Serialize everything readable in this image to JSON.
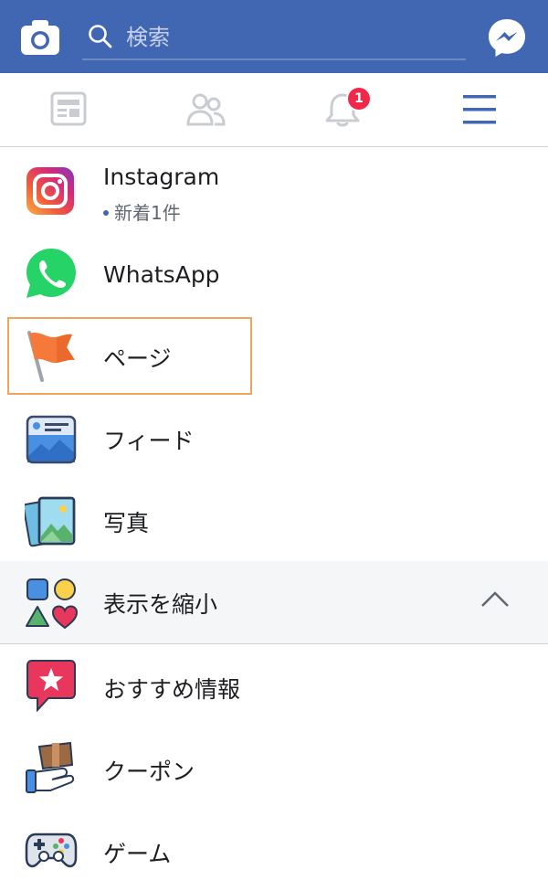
{
  "header": {
    "search_placeholder": "検索",
    "brand_color": "#4267b2"
  },
  "nav": {
    "tabs": [
      {
        "name": "news-feed-icon"
      },
      {
        "name": "friends-icon"
      },
      {
        "name": "notifications-icon",
        "badge": "1"
      },
      {
        "name": "menu-icon",
        "active": true
      }
    ],
    "notification_badge": "1"
  },
  "menu": {
    "items": [
      {
        "label": "Instagram",
        "sub": "新着1件",
        "icon": "instagram-icon"
      },
      {
        "label": "WhatsApp",
        "icon": "whatsapp-icon"
      },
      {
        "label": "ページ",
        "icon": "flag-icon"
      },
      {
        "label": "フィード",
        "icon": "feed-icon"
      },
      {
        "label": "写真",
        "icon": "photos-icon"
      }
    ],
    "collapse": {
      "label": "表示を縮小",
      "icon": "shapes-icon"
    },
    "more": [
      {
        "label": "おすすめ情報",
        "icon": "recommendations-icon"
      },
      {
        "label": "クーポン",
        "icon": "coupon-icon"
      },
      {
        "label": "ゲーム",
        "icon": "gamepad-icon"
      }
    ]
  }
}
